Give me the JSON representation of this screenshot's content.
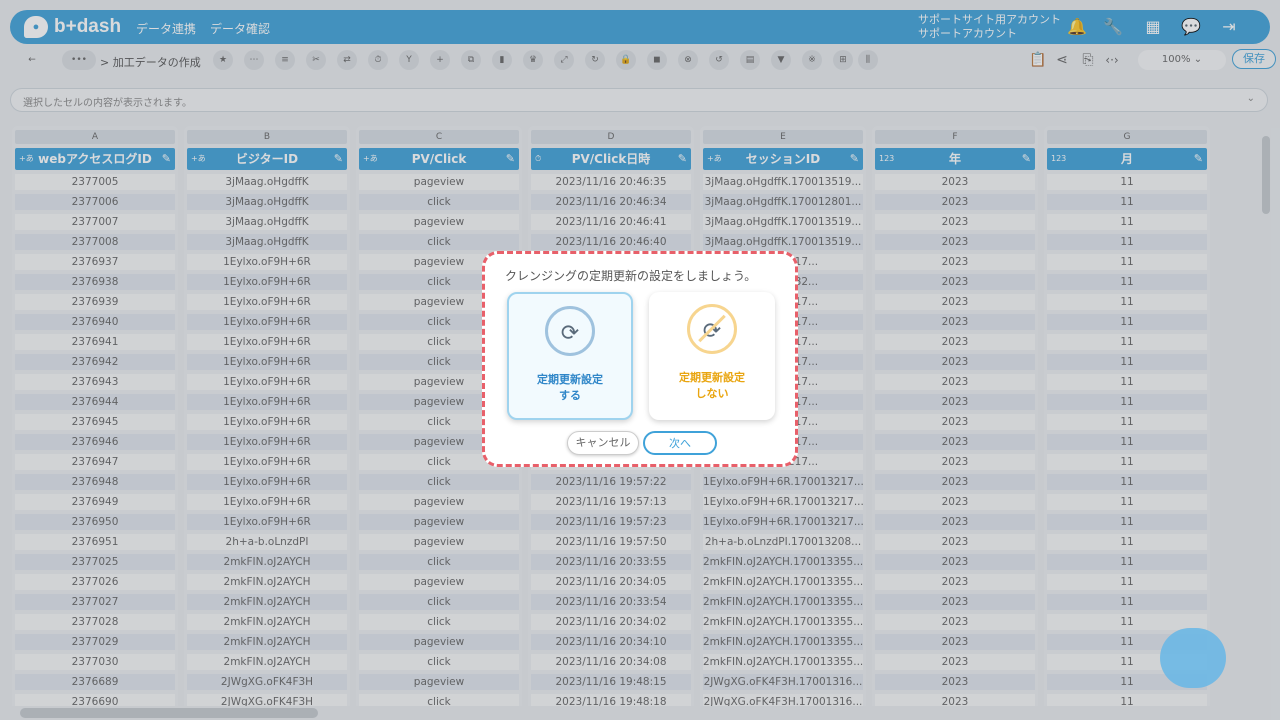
{
  "header": {
    "logo": "b+dash",
    "nav": [
      "データ連携",
      "データ確認"
    ],
    "account_line1": "サポートサイト用アカウント",
    "account_line2": "サポートアカウント"
  },
  "toolbar": {
    "breadcrumb": "> 加工データの作成",
    "zoom": "100%",
    "save": "保存"
  },
  "cellbar": {
    "placeholder": "選択したセルの内容が表示されます。"
  },
  "columns": [
    {
      "letter": "A",
      "header": "webアクセスログID",
      "values": [
        "2377005",
        "2377006",
        "2377007",
        "2377008",
        "2376937",
        "2376938",
        "2376939",
        "2376940",
        "2376941",
        "2376942",
        "2376943",
        "2376944",
        "2376945",
        "2376946",
        "2376947",
        "2376948",
        "2376949",
        "2376950",
        "2376951",
        "2377025",
        "2377026",
        "2377027",
        "2377028",
        "2377029",
        "2377030",
        "2376689",
        "2376690"
      ]
    },
    {
      "letter": "B",
      "header": "ビジターID",
      "values": [
        "3jMaag.oHgdffK",
        "3jMaag.oHgdffK",
        "3jMaag.oHgdffK",
        "3jMaag.oHgdffK",
        "1Eylxo.oF9H+6R",
        "1Eylxo.oF9H+6R",
        "1Eylxo.oF9H+6R",
        "1Eylxo.oF9H+6R",
        "1Eylxo.oF9H+6R",
        "1Eylxo.oF9H+6R",
        "1Eylxo.oF9H+6R",
        "1Eylxo.oF9H+6R",
        "1Eylxo.oF9H+6R",
        "1Eylxo.oF9H+6R",
        "1Eylxo.oF9H+6R",
        "1Eylxo.oF9H+6R",
        "1Eylxo.oF9H+6R",
        "1Eylxo.oF9H+6R",
        "2h+a-b.oLnzdPI",
        "2mkFIN.oJ2AYCH",
        "2mkFIN.oJ2AYCH",
        "2mkFIN.oJ2AYCH",
        "2mkFIN.oJ2AYCH",
        "2mkFIN.oJ2AYCH",
        "2mkFIN.oJ2AYCH",
        "2JWgXG.oFK4F3H",
        "2JWgXG.oFK4F3H"
      ]
    },
    {
      "letter": "C",
      "header": "PV/Click",
      "values": [
        "pageview",
        "click",
        "pageview",
        "click",
        "pageview",
        "click",
        "pageview",
        "click",
        "click",
        "click",
        "pageview",
        "pageview",
        "click",
        "pageview",
        "click",
        "click",
        "pageview",
        "pageview",
        "pageview",
        "click",
        "pageview",
        "click",
        "click",
        "pageview",
        "click",
        "pageview",
        "click"
      ]
    },
    {
      "letter": "D",
      "header": "PV/Click日時",
      "values": [
        "2023/11/16 20:46:35",
        "2023/11/16 20:46:34",
        "2023/11/16 20:46:41",
        "2023/11/16 20:46:40",
        "",
        "",
        "",
        "",
        "",
        "",
        "",
        "",
        "",
        "",
        "",
        "2023/11/16 19:57:22",
        "2023/11/16 19:57:13",
        "2023/11/16 19:57:23",
        "2023/11/16 19:57:50",
        "2023/11/16 20:33:55",
        "2023/11/16 20:34:05",
        "2023/11/16 20:33:54",
        "2023/11/16 20:34:02",
        "2023/11/16 20:34:10",
        "2023/11/16 20:34:08",
        "2023/11/16 19:48:15",
        "2023/11/16 19:48:18"
      ]
    },
    {
      "letter": "E",
      "header": "セッションID",
      "values": [
        "3jMaag.oHgdffK.170013519...",
        "3jMaag.oHgdffK.170012801...",
        "3jMaag.oHgdffK.170013519...",
        "3jMaag.oHgdffK.170013519...",
        "170013217...",
        "170012582...",
        "170013217...",
        "170013217...",
        "170013217...",
        "170013217...",
        "170013217...",
        "170013217...",
        "170013217...",
        "170013217...",
        "170013217...",
        "1Eylxo.oF9H+6R.170013217...",
        "1Eylxo.oF9H+6R.170013217...",
        "1Eylxo.oF9H+6R.170013217...",
        "2h+a-b.oLnzdPI.170013208...",
        "2mkFIN.oJ2AYCH.170013355...",
        "2mkFIN.oJ2AYCH.170013355...",
        "2mkFIN.oJ2AYCH.170013355...",
        "2mkFIN.oJ2AYCH.170013355...",
        "2mkFIN.oJ2AYCH.170013355...",
        "2mkFIN.oJ2AYCH.170013355...",
        "2JWgXG.oFK4F3H.17001316...",
        "2JWgXG.oFK4F3H.17001316..."
      ]
    },
    {
      "letter": "F",
      "header": "年",
      "values": [
        "2023",
        "2023",
        "2023",
        "2023",
        "2023",
        "2023",
        "2023",
        "2023",
        "2023",
        "2023",
        "2023",
        "2023",
        "2023",
        "2023",
        "2023",
        "2023",
        "2023",
        "2023",
        "2023",
        "2023",
        "2023",
        "2023",
        "2023",
        "2023",
        "2023",
        "2023",
        "2023"
      ]
    },
    {
      "letter": "G",
      "header": "月",
      "values": [
        "11",
        "11",
        "11",
        "11",
        "11",
        "11",
        "11",
        "11",
        "11",
        "11",
        "11",
        "11",
        "11",
        "11",
        "11",
        "11",
        "11",
        "11",
        "11",
        "11",
        "11",
        "11",
        "11",
        "11",
        "11",
        "11",
        "11"
      ]
    }
  ],
  "modal": {
    "title": "クレンジングの定期更新の設定をしましょう。",
    "option_on_line1": "定期更新設定",
    "option_on_line2": "する",
    "option_off_line1": "定期更新設定",
    "option_off_line2": "しない",
    "cancel": "キャンセル",
    "next": "次へ"
  },
  "colors": {
    "accent": "#3fa2d9",
    "warning": "#e9a510",
    "modal_border": "#e8606a"
  }
}
